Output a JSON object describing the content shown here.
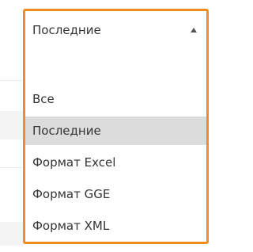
{
  "select": {
    "value": "Последние",
    "caret_icon": "caret-up-icon",
    "accent_color": "#f28c1e",
    "options": [
      {
        "label": ""
      },
      {
        "label": "Все"
      },
      {
        "label": "Последние"
      },
      {
        "label": "Формат Excel"
      },
      {
        "label": "Формат GGE"
      },
      {
        "label": "Формат XML"
      }
    ],
    "selected_index": 2
  }
}
